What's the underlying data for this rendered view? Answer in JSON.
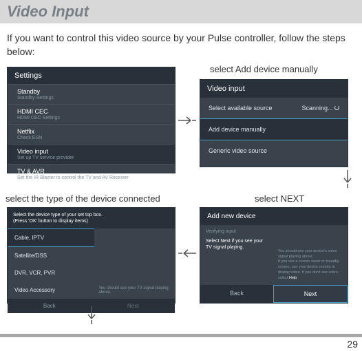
{
  "page": {
    "title": "Video Input",
    "intro": "If you want to control this video source by your Pulse controller, follow the steps below:",
    "number": "29"
  },
  "labels": {
    "add_manually": "select Add device manually",
    "select_type": "select the type of the device connected",
    "select_next": "select NEXT"
  },
  "settings_panel": {
    "title": "Settings",
    "items": [
      {
        "main": "Standby",
        "sub": "Standby Settings"
      },
      {
        "main": "HDMI CEC",
        "sub": "HDMI CEC Settings"
      },
      {
        "main": "Netflix",
        "sub": "Check ESN"
      },
      {
        "main": "Video input",
        "sub": "Set up TV service provider"
      },
      {
        "main": "TV & AVR",
        "sub": "Set the IR Blaster to control the TV and AV Receiver"
      }
    ]
  },
  "video_panel": {
    "title": "Video input",
    "row1_label": "Select available source",
    "row1_status": "Scanning...",
    "row2": "Add device manually",
    "row3": "Generic video source"
  },
  "add_panel": {
    "title": "Add new device",
    "sub1": "Verifying input",
    "sub2": "Select Next if you see your TV signal playing.",
    "hint1": "You should see your device's video signal playing above.",
    "hint2a": "If you see a screen saver or standby screen, use your device remote to display video. If you don't see video, select ",
    "hint2b": "Help",
    "hint2c": ".",
    "back": "Back",
    "next": "Next"
  },
  "type_panel": {
    "title_line1": "Select the device type of your set top box.",
    "title_line2": "(Press 'OK' button to display items)",
    "options": [
      "Cable, IPTV",
      "Satellite/DSS",
      "DVR, VCR, PVR",
      "Video Accessory"
    ],
    "hint": "You should see your TV signal playing above.",
    "back": "Back",
    "next": "Next"
  }
}
